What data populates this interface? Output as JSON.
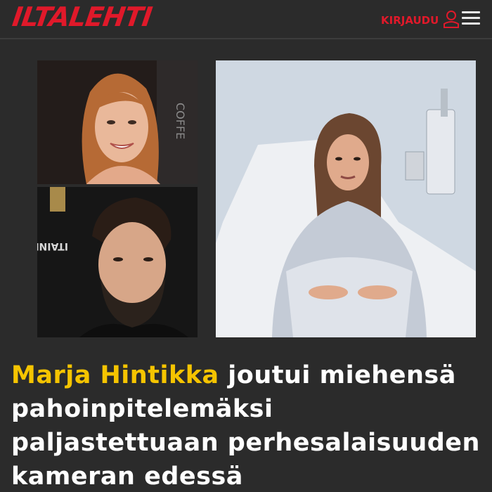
{
  "header": {
    "logo_text": "ILTALEHTI",
    "login_label": "KIRJAUDU",
    "user_icon": "user-icon",
    "menu_icon": "hamburger-menu-icon"
  },
  "article": {
    "headline_name": "Marja Hintikka",
    "headline_rest": " joutui miehensä pahoinpitelemäksi paljastettuaan perhesalaisuuden kameran edessä",
    "photo_sign_text": "ITAINEN"
  },
  "colors": {
    "brand_red": "#e0192a",
    "highlight_yellow": "#f5c400",
    "background": "#2b2b2b"
  }
}
